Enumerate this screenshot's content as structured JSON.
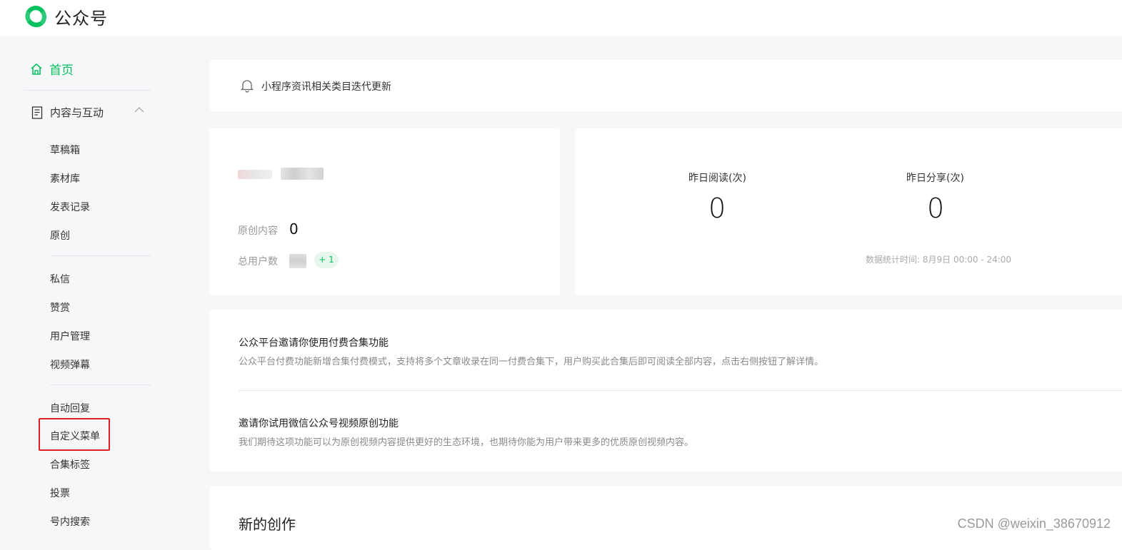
{
  "brand": {
    "name": "公众号",
    "logo": "wechat-mp-logo",
    "accent": "#07c160"
  },
  "sidebar": {
    "home": "首页",
    "group": {
      "label": "内容与互动",
      "expanded": true
    },
    "items": [
      {
        "label": "草稿箱"
      },
      {
        "label": "素材库"
      },
      {
        "label": "发表记录"
      },
      {
        "label": "原创"
      },
      {
        "label": "私信"
      },
      {
        "label": "赞赏"
      },
      {
        "label": "用户管理"
      },
      {
        "label": "视频弹幕"
      },
      {
        "label": "自动回复"
      },
      {
        "label": "自定义菜单"
      },
      {
        "label": "合集标签"
      },
      {
        "label": "投票"
      },
      {
        "label": "号内搜索"
      }
    ],
    "highlight_color": "#e02020"
  },
  "notice": {
    "text": "小程序资讯相关类目迭代更新",
    "icon": "bell-icon"
  },
  "profile": {
    "original_label": "原创内容",
    "original_value": "0",
    "users_label": "总用户数",
    "users_delta": "+ 1"
  },
  "stats": {
    "read_label": "昨日阅读(次)",
    "read_value": "0",
    "share_label": "昨日分享(次)",
    "share_value": "0",
    "time_text": "数据统计时间: 8月9日 00:00 - 24:00"
  },
  "invites": [
    {
      "title": "公众平台邀请你使用付费合集功能",
      "desc": "公众平台付费功能新增合集付费模式，支持将多个文章收录在同一付费合集下，用户购买此合集后即可阅读全部内容，点击右侧按钮了解详情。"
    },
    {
      "title": "邀请你试用微信公众号视频原创功能",
      "desc": "我们期待这项功能可以为原创视频内容提供更好的生态环境，也期待你能为用户带来更多的优质原创视频内容。"
    }
  ],
  "create": {
    "title": "新的创作"
  },
  "watermark": "CSDN @weixin_38670912"
}
